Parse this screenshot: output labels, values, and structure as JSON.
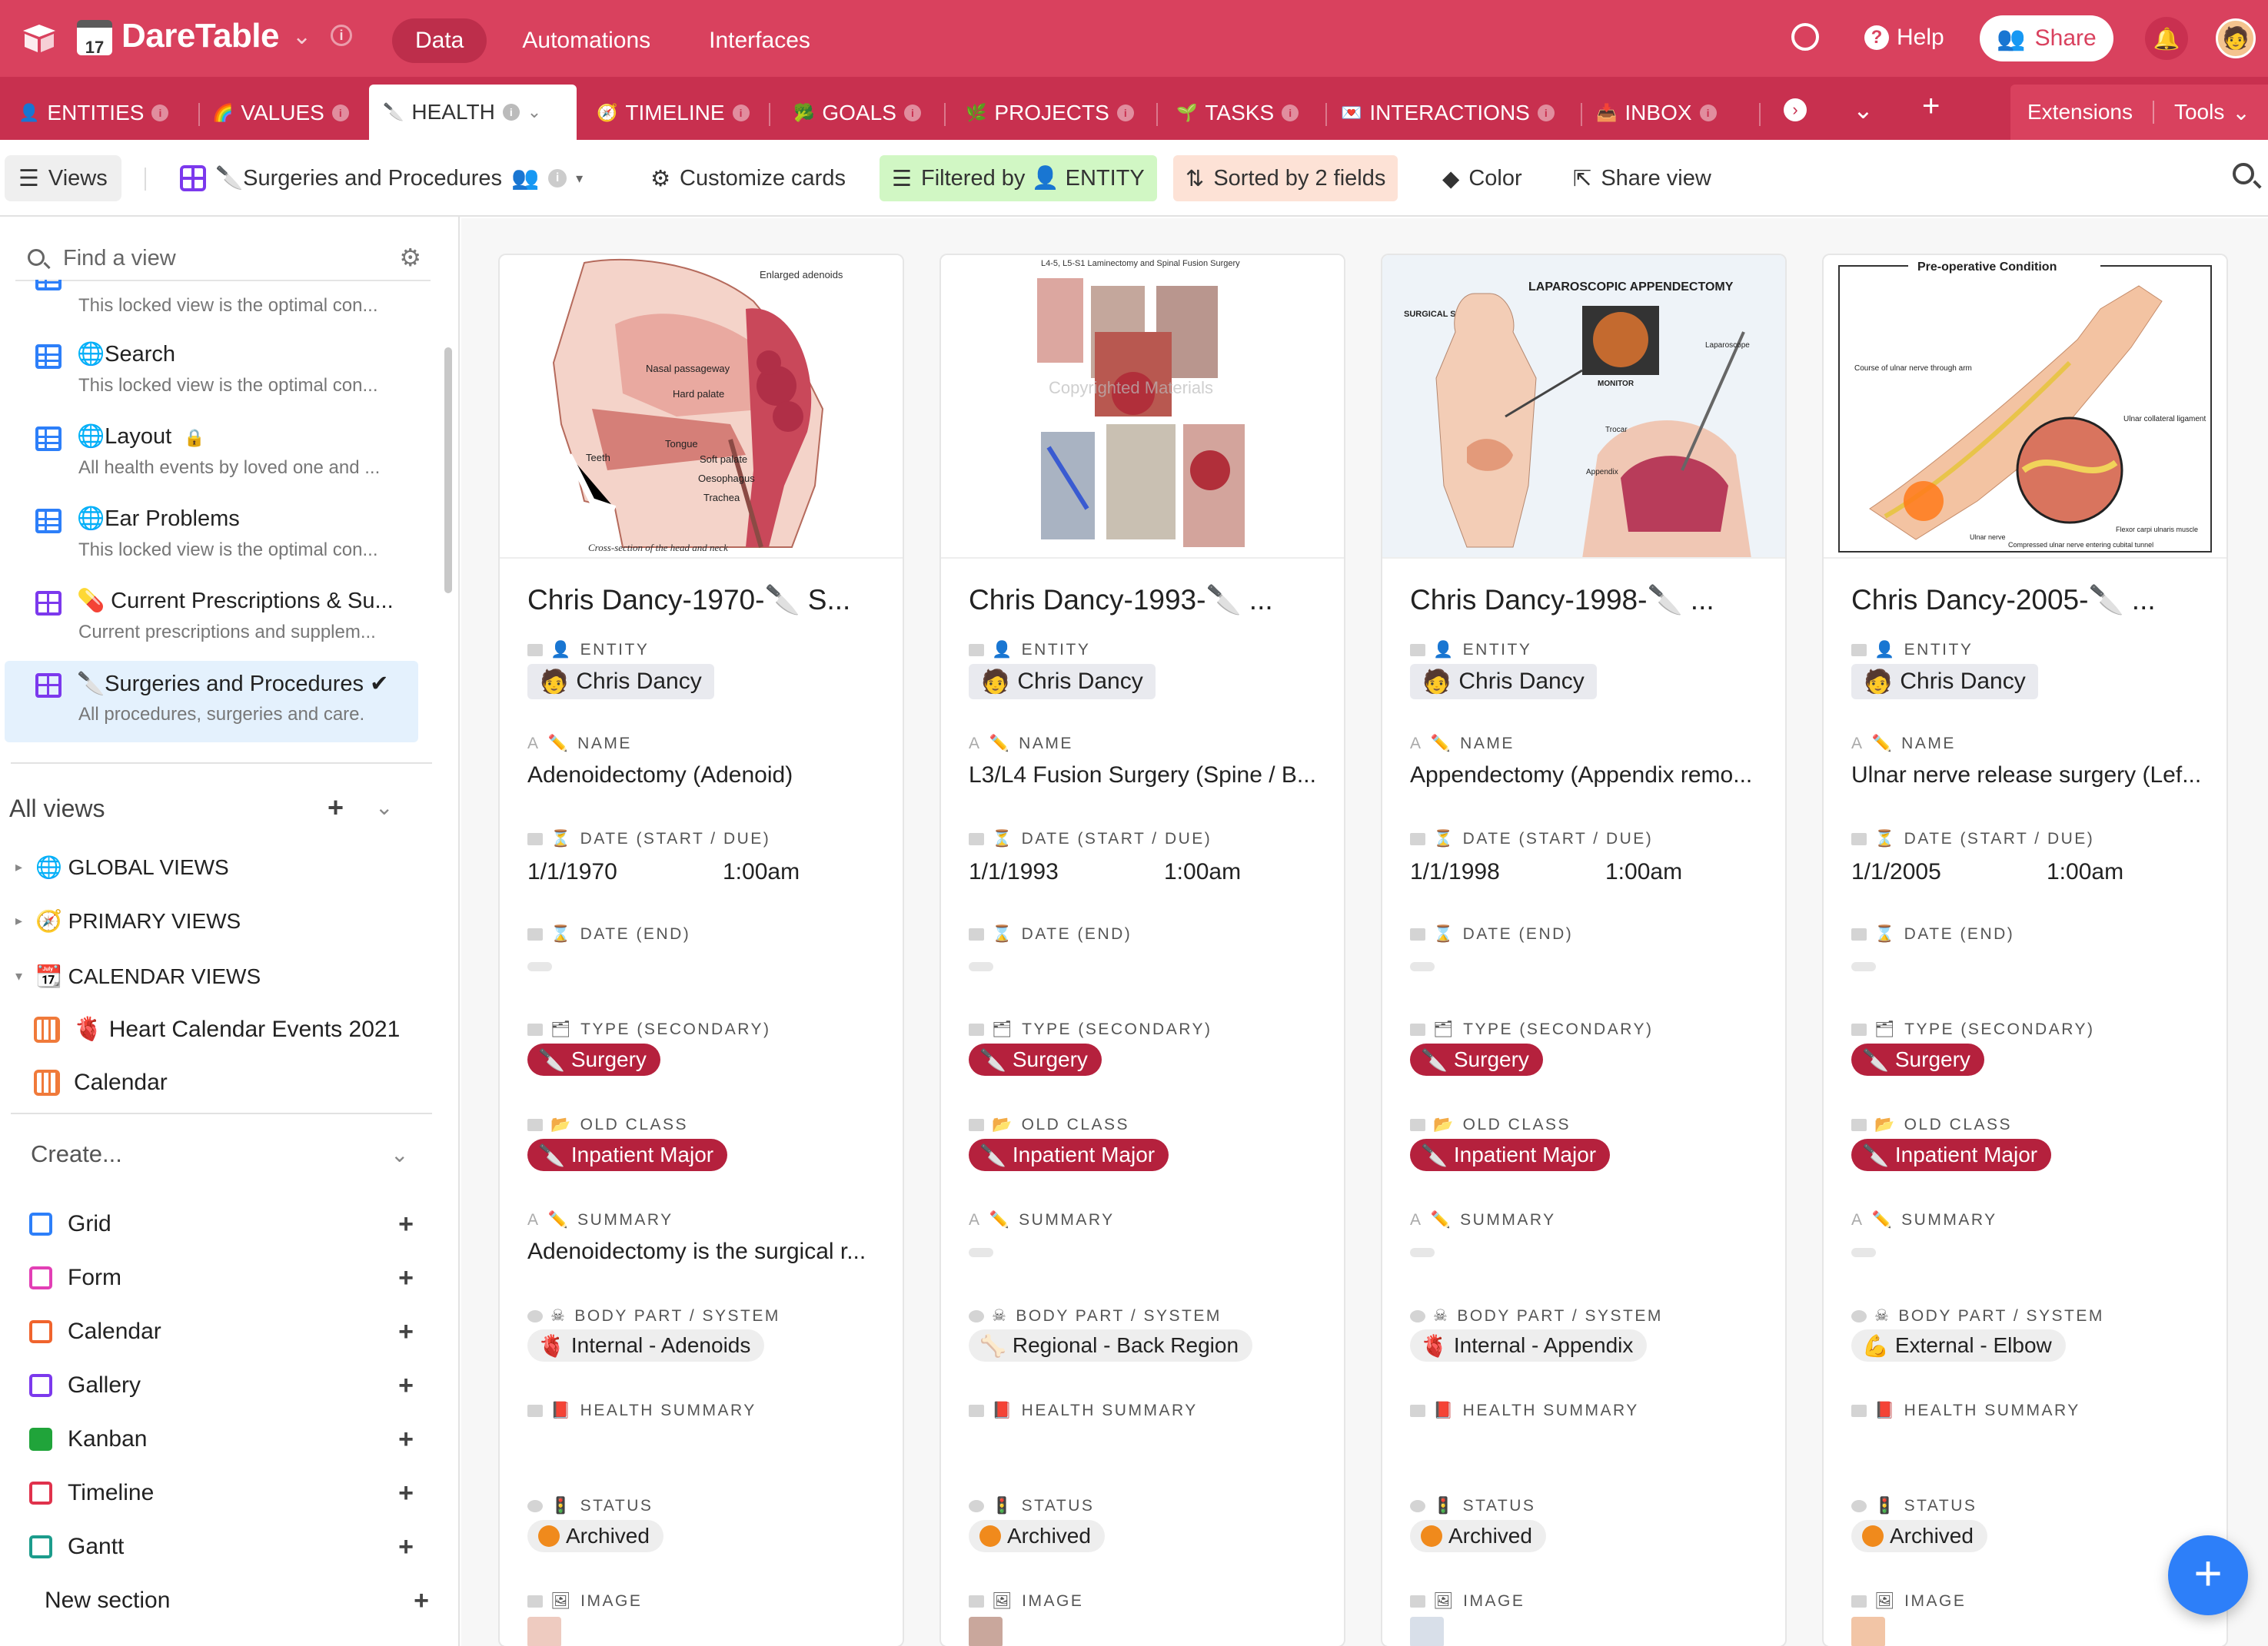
{
  "app": {
    "name": "DareTable",
    "calendar_day": "17",
    "nav": [
      "Data",
      "Automations",
      "Interfaces"
    ],
    "help": "Help",
    "share": "Share"
  },
  "tabs": [
    {
      "icon": "👤",
      "label": "ENTITIES"
    },
    {
      "icon": "🌈",
      "label": "VALUES"
    },
    {
      "icon": "🔪",
      "label": "HEALTH"
    },
    {
      "icon": "🧭",
      "label": "TIMELINE"
    },
    {
      "icon": "🥦",
      "label": "GOALS"
    },
    {
      "icon": "🌿",
      "label": "PROJECTS"
    },
    {
      "icon": "🌱",
      "label": "TASKS"
    },
    {
      "icon": "💌",
      "label": "INTERACTIONS"
    },
    {
      "icon": "📥",
      "label": "INBOX"
    }
  ],
  "tabbar_extra": {
    "extensions": "Extensions",
    "tools": "Tools"
  },
  "toolbar": {
    "views": "Views",
    "view_name": "🔪Surgeries and Procedures",
    "customize": "Customize cards",
    "filter": "Filtered by 👤 ENTITY",
    "sort": "Sorted by 2 fields",
    "color": "Color",
    "share_view": "Share view"
  },
  "sidebar": {
    "find_placeholder": "Find a view",
    "views": [
      {
        "name": "",
        "desc": "This locked view is the optimal con...",
        "type": "grid"
      },
      {
        "name": "🌐Search",
        "desc": "This locked view is the optimal con...",
        "type": "grid"
      },
      {
        "name": "🌐Layout",
        "desc": "All health events by loved one and ...",
        "type": "grid"
      },
      {
        "name": "🌐Ear Problems",
        "desc": "This locked view is the optimal con...",
        "type": "grid"
      },
      {
        "name": "💊 Current Prescriptions & Su...",
        "desc": "Current prescriptions and supplem...",
        "type": "gallery"
      },
      {
        "name": "🔪Surgeries and Procedures ✔",
        "desc": "All procedures, surgeries and care.",
        "type": "gallery"
      }
    ],
    "all_views": "All views",
    "sections": [
      "🌐 GLOBAL VIEWS",
      "🧭 PRIMARY VIEWS",
      "📆 CALENDAR VIEWS"
    ],
    "calendar_views": [
      "🫀 Heart Calendar Events 2021",
      "Calendar"
    ],
    "create": "Create...",
    "create_items": [
      {
        "label": "Grid",
        "color": "#2d7ff9"
      },
      {
        "label": "Form",
        "color": "#e23fb5"
      },
      {
        "label": "Calendar",
        "color": "#f0642d"
      },
      {
        "label": "Gallery",
        "color": "#7c39ed"
      },
      {
        "label": "Kanban",
        "color": "#20a43a"
      },
      {
        "label": "Timeline",
        "color": "#e0324c"
      },
      {
        "label": "Gantt",
        "color": "#1c9c8c"
      }
    ],
    "new_section": "New section"
  },
  "field_labels": {
    "entity": "ENTITY",
    "name": "NAME",
    "date_start": "DATE (START / DUE)",
    "date_end": "DATE (END)",
    "type": "TYPE (SECONDARY)",
    "old_class": "OLD CLASS",
    "summary": "SUMMARY",
    "body_part": "BODY PART / SYSTEM",
    "health_summary": "HEALTH SUMMARY",
    "status": "STATUS",
    "image": "IMAGE"
  },
  "cards": [
    {
      "title": "Chris Dancy-1970-🔪 S...",
      "entity": "Chris Dancy",
      "name": "Adenoidectomy (Adenoid)",
      "date": "1/1/1970",
      "time": "1:00am",
      "type": "Surgery",
      "old_class": "Inpatient Major",
      "summary": "Adenoidectomy is the surgical r...",
      "body_icon": "🫀",
      "body_part": "Internal - Adenoids",
      "status": "Archived",
      "image_labels": [
        "Enlarged adenoids",
        "Nasal passageway",
        "Hard palate",
        "Tongue",
        "Soft palate",
        "Teeth",
        "Oesophagus",
        "Trachea",
        "Cross-section of the head and neck"
      ]
    },
    {
      "title": "Chris Dancy-1993-🔪 ...",
      "entity": "Chris Dancy",
      "name": "L3/L4 Fusion Surgery (Spine / B...",
      "date": "1/1/1993",
      "time": "1:00am",
      "type": "Surgery",
      "old_class": "Inpatient Major",
      "summary": "",
      "body_icon": "🦴",
      "body_part": "Regional - Back Region",
      "status": "Archived",
      "image_labels": [
        "L4-5, L5-S1 Laminectomy and Spinal Fusion Surgery"
      ]
    },
    {
      "title": "Chris Dancy-1998-🔪 ...",
      "entity": "Chris Dancy",
      "name": "Appendectomy (Appendix remo...",
      "date": "1/1/1998",
      "time": "1:00am",
      "type": "Surgery",
      "old_class": "Inpatient Major",
      "summary": "",
      "body_icon": "🫀",
      "body_part": "Internal - Appendix",
      "status": "Archived",
      "image_labels": [
        "LAPAROSCOPIC APPENDECTOMY",
        "SURGICAL SET-UP",
        "MONITOR",
        "Laparoscope",
        "Trocar",
        "Appendix"
      ]
    },
    {
      "title": "Chris Dancy-2005-🔪 ...",
      "entity": "Chris Dancy",
      "name": "Ulnar nerve release surgery (Lef...",
      "date": "1/1/2005",
      "time": "1:00am",
      "type": "Surgery",
      "old_class": "Inpatient Major",
      "summary": "",
      "body_icon": "💪",
      "body_part": "External - Elbow",
      "status": "Archived",
      "image_labels": [
        "Pre-operative Condition",
        "Course of ulnar nerve through arm",
        "Ulnar collateral ligament",
        "Ulnar nerve",
        "Compressed ulnar nerve entering cubital tunnel",
        "Flexor carpi ulnaris muscle"
      ]
    }
  ]
}
